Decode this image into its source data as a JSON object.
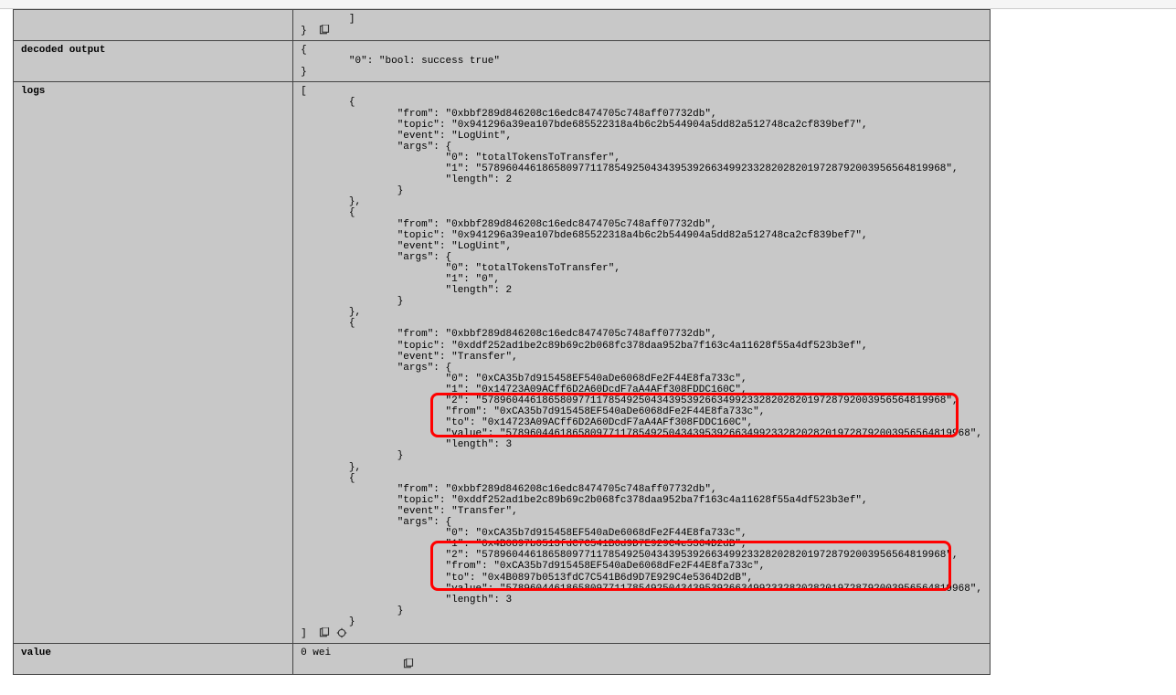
{
  "labels": {
    "row0": "",
    "decoded_output": "decoded output",
    "logs": "logs",
    "value": "value"
  },
  "cells": {
    "top_fragment": "        ]\n} ",
    "decoded_output": "{\n        \"0\": \"bool: success true\"\n}",
    "logs": "[\n        {\n                \"from\": \"0xbbf289d846208c16edc8474705c748aff07732db\",\n                \"topic\": \"0x941296a39ea107bde685522318a4b6c2b544904a5dd82a512748ca2cf839bef7\",\n                \"event\": \"LogUint\",\n                \"args\": {\n                        \"0\": \"totalTokensToTransfer\",\n                        \"1\": \"57896044618658097711785492504343953926634992332820282019728792003956564819968\",\n                        \"length\": 2\n                }\n        },\n        {\n                \"from\": \"0xbbf289d846208c16edc8474705c748aff07732db\",\n                \"topic\": \"0x941296a39ea107bde685522318a4b6c2b544904a5dd82a512748ca2cf839bef7\",\n                \"event\": \"LogUint\",\n                \"args\": {\n                        \"0\": \"totalTokensToTransfer\",\n                        \"1\": \"0\",\n                        \"length\": 2\n                }\n        },\n        {\n                \"from\": \"0xbbf289d846208c16edc8474705c748aff07732db\",\n                \"topic\": \"0xddf252ad1be2c89b69c2b068fc378daa952ba7f163c4a11628f55a4df523b3ef\",\n                \"event\": \"Transfer\",\n                \"args\": {\n                        \"0\": \"0xCA35b7d915458EF540aDe6068dFe2F44E8fa733c\",\n                        \"1\": \"0x14723A09ACff6D2A60DcdF7aA4AFf308FDDC160C\",\n                        \"2\": \"57896044618658097711785492504343953926634992332820282019728792003956564819968\",\n                        \"from\": \"0xCA35b7d915458EF540aDe6068dFe2F44E8fa733c\",\n                        \"to\": \"0x14723A09ACff6D2A60DcdF7aA4AFf308FDDC160C\",\n                        \"value\": \"57896044618658097711785492504343953926634992332820282019728792003956564819968\",\n                        \"length\": 3\n                }\n        },\n        {\n                \"from\": \"0xbbf289d846208c16edc8474705c748aff07732db\",\n                \"topic\": \"0xddf252ad1be2c89b69c2b068fc378daa952ba7f163c4a11628f55a4df523b3ef\",\n                \"event\": \"Transfer\",\n                \"args\": {\n                        \"0\": \"0xCA35b7d915458EF540aDe6068dFe2F44E8fa733c\",\n                        \"1\": \"0x4B0897b0513fdC7C541B6d9D7E929C4e5364D2dB\",\n                        \"2\": \"57896044618658097711785492504343953926634992332820282019728792003956564819968\",\n                        \"from\": \"0xCA35b7d915458EF540aDe6068dFe2F44E8fa733c\",\n                        \"to\": \"0x4B0897b0513fdC7C541B6d9D7E929C4e5364D2dB\",\n                        \"value\": \"57896044618658097711785492504343953926634992332820282019728792003956564819968\",\n                        \"length\": 3\n                }\n        }\n] ",
    "value": "0 wei\n                "
  }
}
